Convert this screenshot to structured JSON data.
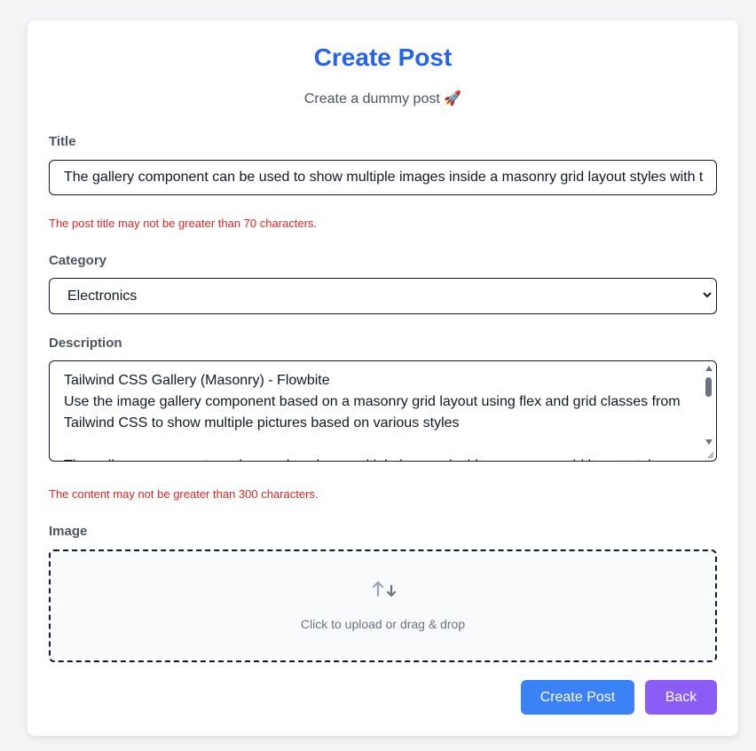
{
  "header": {
    "title": "Create Post",
    "subtitle": "Create a dummy post 🚀"
  },
  "form": {
    "title_label": "Title",
    "title_value": "The gallery component can be used to show multiple images inside a masonry grid layout styles with t",
    "title_error": "The post title may not be greater than 70 characters.",
    "category_label": "Category",
    "category_value": "Electronics",
    "description_label": "Description",
    "description_value": "Tailwind CSS Gallery (Masonry) - Flowbite\nUse the image gallery component based on a masonry grid layout using flex and grid classes from Tailwind CSS to show multiple pictures based on various styles\n\nThe gallery component can be used to show multiple images inside a masonry grid layout styles with",
    "description_error": "The content may not be greater than 300 characters.",
    "image_label": "Image",
    "upload_text": "Click to upload or drag & drop",
    "upload_icon": "upload-arrows-icon"
  },
  "actions": {
    "create_label": "Create Post",
    "back_label": "Back"
  },
  "colors": {
    "title": "#2563eb",
    "error": "#dc2626",
    "create_button": "#3b82f6",
    "back_button": "#8b5cf6"
  }
}
